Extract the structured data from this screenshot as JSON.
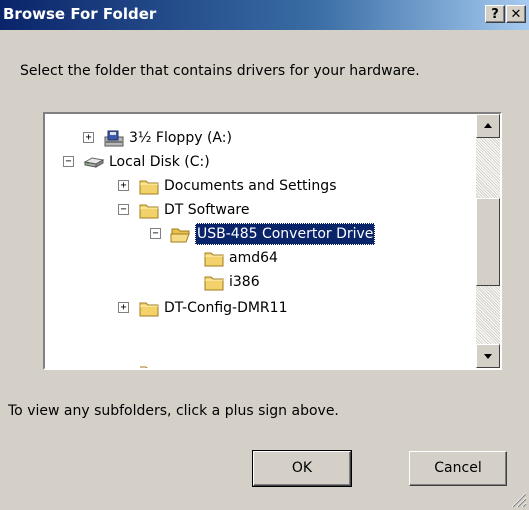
{
  "window": {
    "title": "Browse For Folder",
    "help_glyph": "?",
    "close_glyph": "✕"
  },
  "prompt": "Select the folder that contains drivers for your hardware.",
  "tree": {
    "nodes": [
      {
        "label": "3½ Floppy (A:)",
        "expander": "+",
        "icon": "floppy-drive-icon"
      },
      {
        "label": "Local Disk (C:)",
        "expander": "−",
        "icon": "hard-disk-icon"
      },
      {
        "label": "Documents and Settings",
        "expander": "+",
        "icon": "folder-icon"
      },
      {
        "label": "DT Software",
        "expander": "−",
        "icon": "folder-icon"
      },
      {
        "label": "USB-485 Convertor Drive",
        "expander": "−",
        "icon": "open-folder-icon",
        "selected": true
      },
      {
        "label": "amd64",
        "expander": "",
        "icon": "folder-icon"
      },
      {
        "label": "i386",
        "expander": "",
        "icon": "folder-icon"
      },
      {
        "label": "DT-Config-DMR11",
        "expander": "+",
        "icon": "folder-icon"
      }
    ]
  },
  "hint": "To view any subfolders, click a plus sign above.",
  "buttons": {
    "ok": "OK",
    "cancel": "Cancel"
  },
  "colors": {
    "title_bar": "#0a246a",
    "selection": "#0a246a",
    "dialog_bg": "#d4d0c8",
    "folder": "#f3d26b"
  }
}
